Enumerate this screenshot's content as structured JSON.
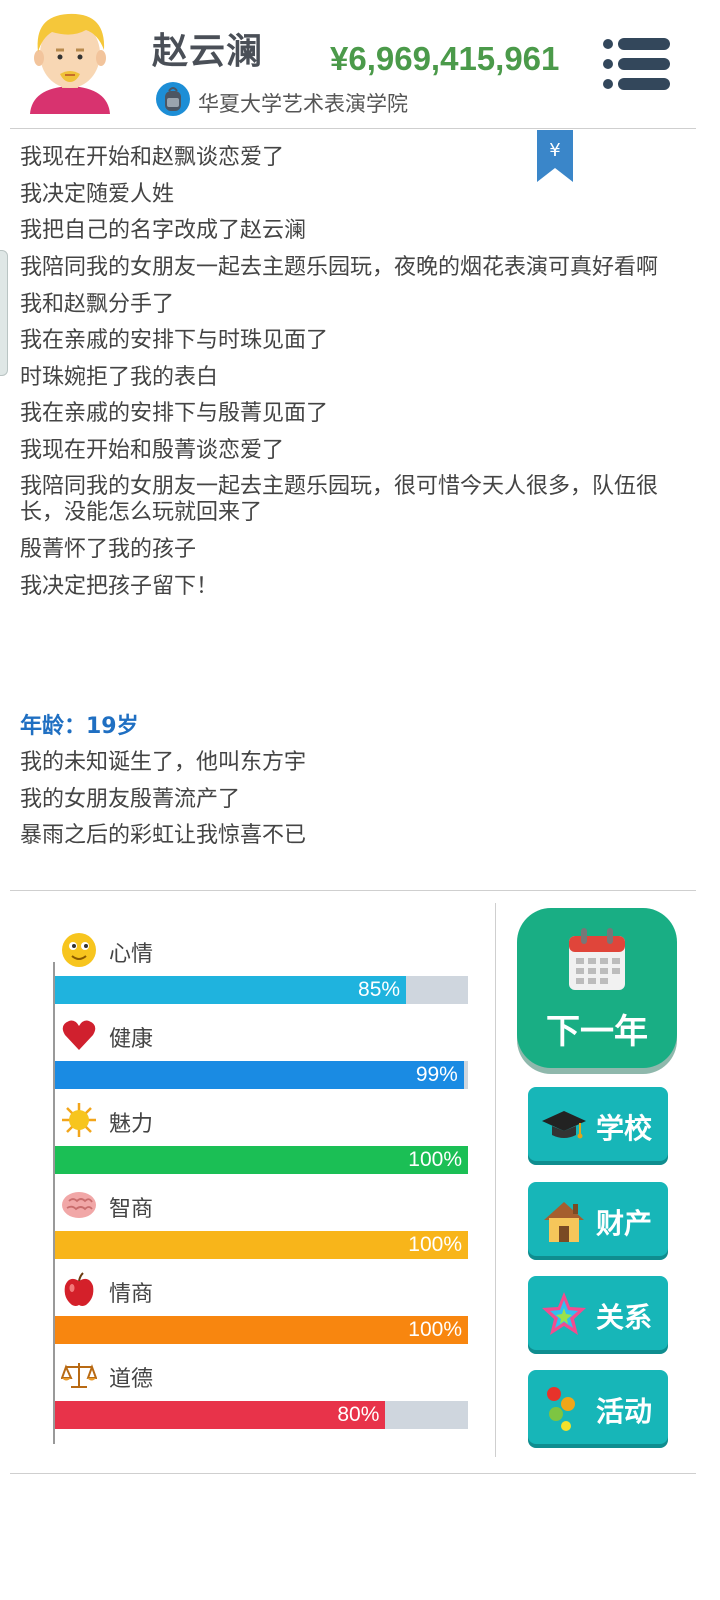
{
  "header": {
    "name": "赵云澜",
    "school": "华夏大学艺术表演学院",
    "money": "¥6,969,415,961"
  },
  "log": {
    "lines_before": [
      "我现在开始和赵飘谈恋爱了",
      "我决定随爱人姓",
      "我把自己的名字改成了赵云澜",
      "我陪同我的女朋友一起去主题乐园玩，夜晚的烟花表演可真好看啊",
      "我和赵飘分手了",
      "我在亲戚的安排下与时珠见面了",
      "时珠婉拒了我的表白",
      "我在亲戚的安排下与殷菁见面了",
      "我现在开始和殷菁谈恋爱了",
      "我陪同我的女朋友一起去主题乐园玩，很可惜今天人很多，队伍很长，没能怎么玩就回来了",
      "殷菁怀了我的孩子",
      "我决定把孩子留下！"
    ],
    "age_label": "年龄：19岁",
    "lines_after": [
      "我的未知诞生了，他叫东方宇",
      "我的女朋友殷菁流产了",
      "暴雨之后的彩虹让我惊喜不已"
    ]
  },
  "stats": [
    {
      "label": "心情",
      "value": 85,
      "text": "85%",
      "color": "#1fb3de",
      "icon": "smiley-face-icon"
    },
    {
      "label": "健康",
      "value": 99,
      "text": "99%",
      "color": "#1a8be3",
      "icon": "heart-icon"
    },
    {
      "label": "魅力",
      "value": 100,
      "text": "100%",
      "color": "#1bbf55",
      "icon": "sun-icon"
    },
    {
      "label": "智商",
      "value": 100,
      "text": "100%",
      "color": "#f8b51a",
      "icon": "brain-icon"
    },
    {
      "label": "情商",
      "value": 100,
      "text": "100%",
      "color": "#f8860f",
      "icon": "apple-icon"
    },
    {
      "label": "道德",
      "value": 80,
      "text": "80%",
      "color": "#e8334a",
      "icon": "scales-icon"
    }
  ],
  "buttons": {
    "next_year": "下一年",
    "school": "学校",
    "property": "财产",
    "relations": "关系",
    "activities": "活动"
  },
  "colors": {
    "money": "#4b9a4a",
    "age": "#1f6fc2",
    "next_button": "#19ae84",
    "action_button": "#17b6b8"
  }
}
